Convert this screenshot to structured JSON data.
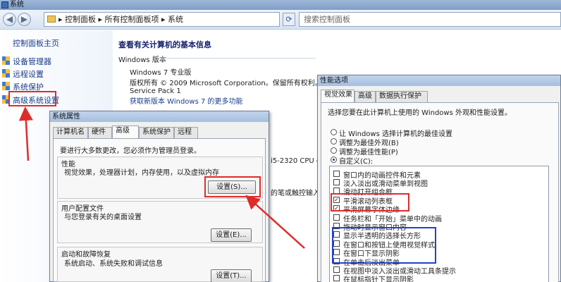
{
  "window": {
    "title": "系统"
  },
  "address": {
    "crumbs": "▸ 控制面板 ▸ 所有控制面板项 ▸ 系统",
    "search_placeholder": "搜索控制面板",
    "back_glyph": "◀",
    "forward_glyph": "▶",
    "refresh_glyph": "⟳"
  },
  "sidebar": {
    "home": "控制面板主页",
    "items": [
      {
        "label": "设备管理器",
        "icon": "shield-icon"
      },
      {
        "label": "远程设置",
        "icon": "shield-icon"
      },
      {
        "label": "系统保护",
        "icon": "shield-icon"
      },
      {
        "label": "高级系统设置",
        "icon": "shield-icon"
      }
    ]
  },
  "main": {
    "heading": "查看有关计算机的基本信息",
    "section": "Windows 版本",
    "edition": "Windows 7 专业版",
    "copyright": "版权所有 © 2009 Microsoft Corporation。保留所有权利。",
    "service_pack": "Service Pack 1",
    "more_features": "获取新版本 Windows 7 的更多功能",
    "cpu_fragment": "i5-2320 CPU @",
    "pen_fragment": "的笔或触控输入"
  },
  "system_properties": {
    "title": "系统属性",
    "tabs": [
      "计算机名",
      "硬件",
      "高级",
      "系统保护",
      "远程"
    ],
    "active_tab": "高级",
    "admin_note": "要进行大多数更改，您必须作为管理员登录。",
    "performance": {
      "title": "性能",
      "desc": "视觉效果，处理器计划，内存使用，以及虚拟内存",
      "button": "设置(S)..."
    },
    "user_profile": {
      "title": "用户配置文件",
      "desc": "与您登录有关的桌面设置",
      "button": "设置(E)..."
    },
    "startup": {
      "title": "启动和故障恢复",
      "desc": "系统启动、系统失败和调试信息",
      "button": "设置(T)..."
    }
  },
  "performance_options": {
    "title": "性能选项",
    "tabs": [
      "视觉效果",
      "高级",
      "数据执行保护"
    ],
    "active_tab": "视觉效果",
    "intro": "选择您要在此计算机上使用的 Windows 外观和性能设置。",
    "radios": [
      {
        "label": "让 Windows 选择计算机的最佳设置",
        "checked": false
      },
      {
        "label": "调整为最佳外观(B)",
        "checked": false
      },
      {
        "label": "调整为最佳性能(P)",
        "checked": false
      },
      {
        "label": "自定义(C):",
        "checked": true
      }
    ],
    "options": [
      {
        "label": "窗口内的动画控件和元素",
        "checked": false
      },
      {
        "label": "淡入淡出或滑动菜单到视图",
        "checked": false
      },
      {
        "label": "滑动打开组合框",
        "checked": false
      },
      {
        "label": "平滑滚动列表框",
        "checked": true
      },
      {
        "label": "平滑屏幕字体边缘",
        "checked": true
      },
      {
        "label": "任务栏和「开始」菜单中的动画",
        "checked": false
      },
      {
        "label": "拖动时显示窗口内容",
        "checked": false
      },
      {
        "label": "显示半透明的选择长方形",
        "checked": false
      },
      {
        "label": "在窗口和按钮上使用视觉样式",
        "checked": false
      },
      {
        "label": "在窗口下显示阴影",
        "checked": false
      },
      {
        "label": "在单击后淡出菜单",
        "checked": false
      },
      {
        "label": "在视图中淡入淡出或滑动工具条提示",
        "checked": false
      },
      {
        "label": "在鼠标指针下显示阴影",
        "checked": false
      }
    ]
  },
  "colors": {
    "annotation_red": "#e02b2b",
    "annotation_blue": "#2341c9"
  }
}
